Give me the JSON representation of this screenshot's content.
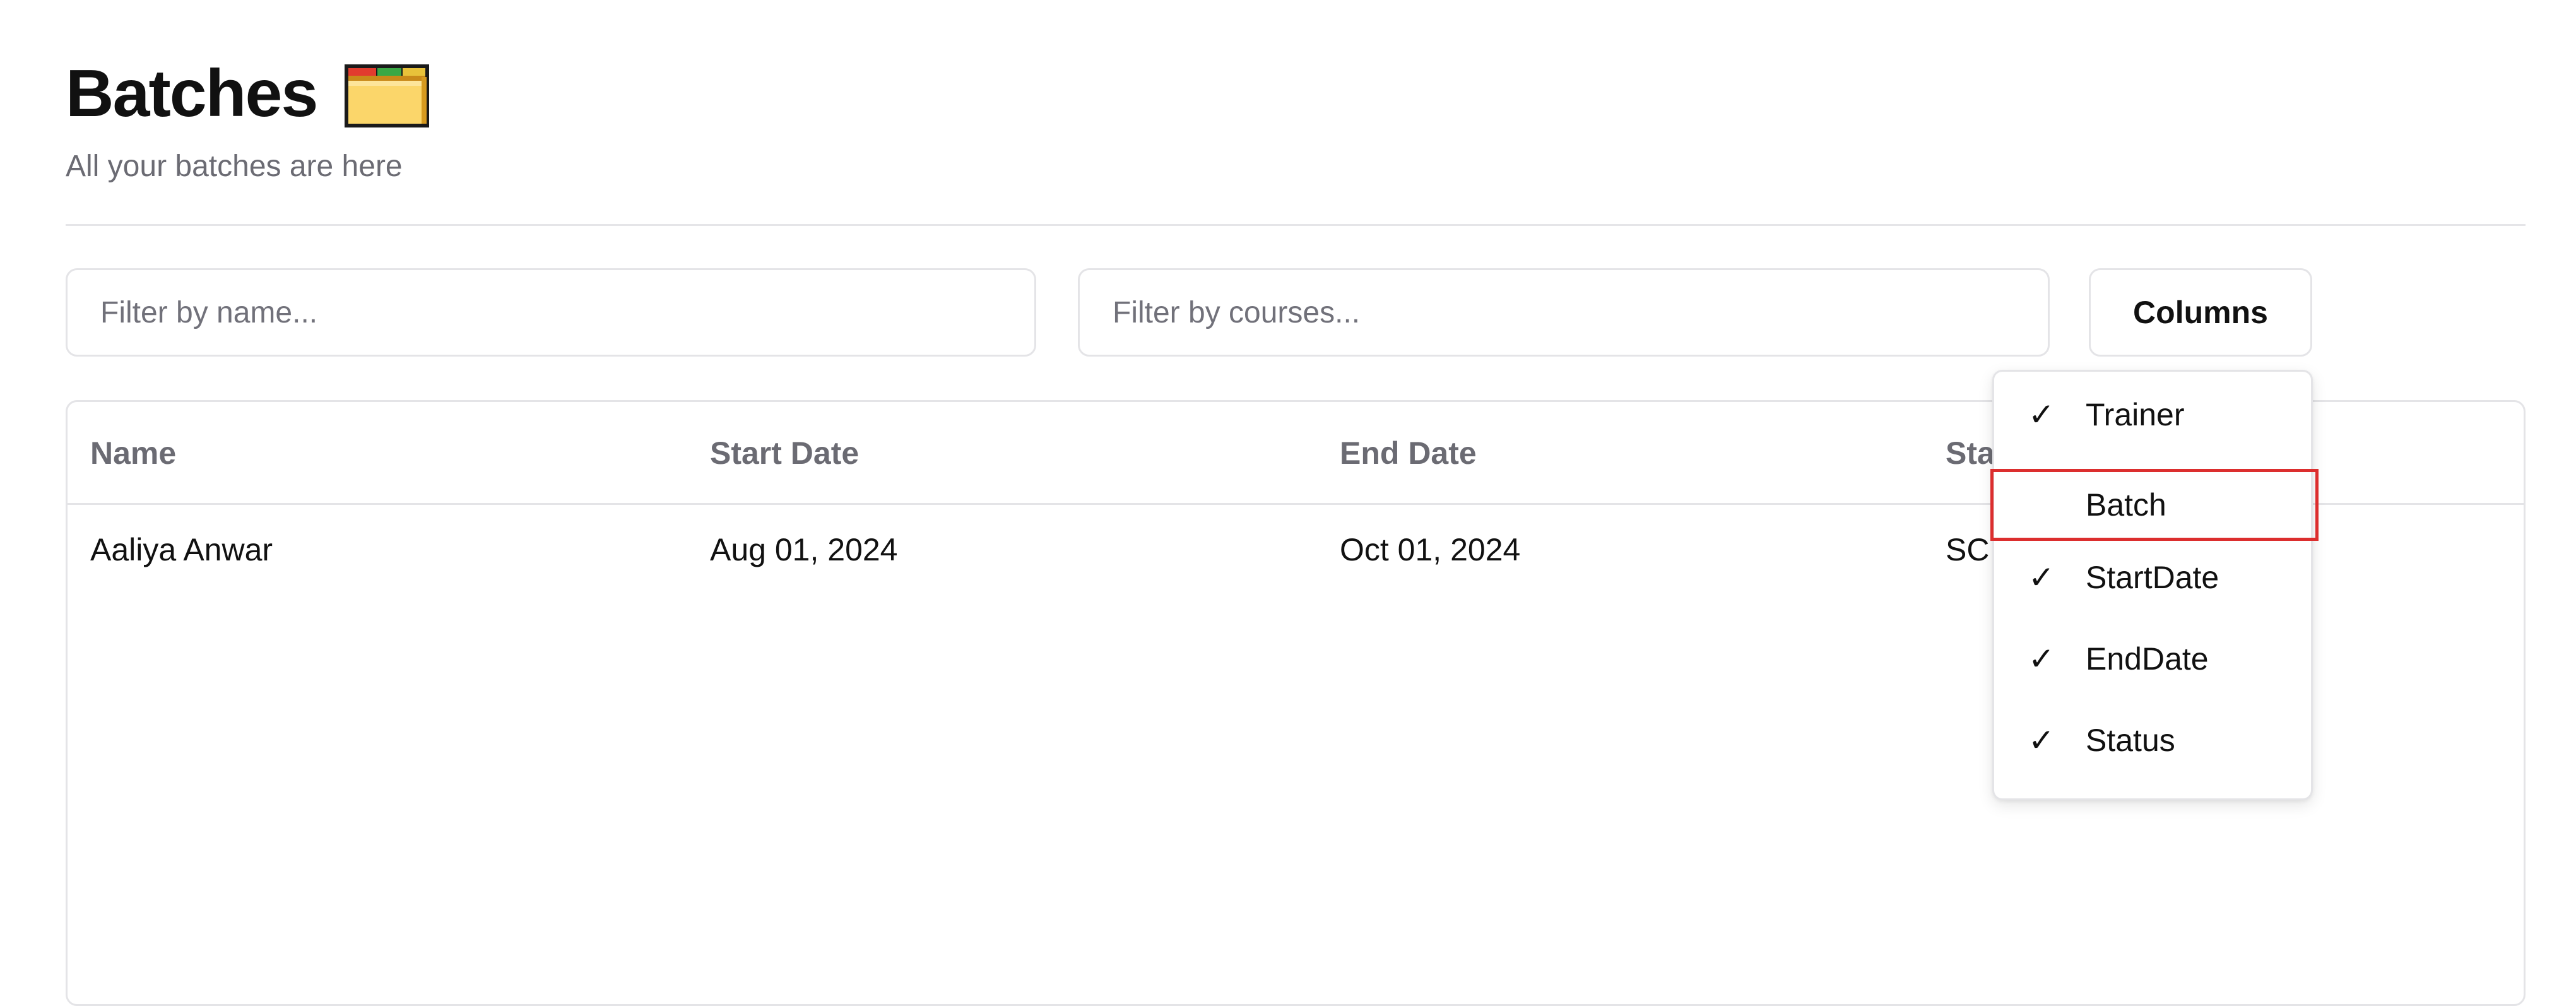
{
  "header": {
    "title": "Batches",
    "title_icon": "folder-icon",
    "subtitle": "All your batches are here"
  },
  "filters": {
    "name_placeholder": "Filter by name...",
    "name_value": "",
    "courses_placeholder": "Filter by courses...",
    "courses_value": ""
  },
  "toolbar": {
    "columns_label": "Columns"
  },
  "table": {
    "columns": [
      "Name",
      "Start Date",
      "End Date",
      "Sta"
    ],
    "rows": [
      {
        "name": "Aaliya Anwar",
        "start_date": "Aug 01, 2024",
        "end_date": "Oct 01, 2024",
        "status": "SC"
      }
    ]
  },
  "columns_menu": {
    "items": [
      {
        "label": "Trainer",
        "checked": true,
        "check_glyph": "✓"
      },
      {
        "label": "Batch",
        "checked": false,
        "check_glyph": ""
      },
      {
        "label": "StartDate",
        "checked": true,
        "check_glyph": "✓"
      },
      {
        "label": "EndDate",
        "checked": true,
        "check_glyph": "✓"
      },
      {
        "label": "Status",
        "checked": true,
        "check_glyph": "✓"
      }
    ],
    "highlight_color": "#dc2e2e"
  }
}
